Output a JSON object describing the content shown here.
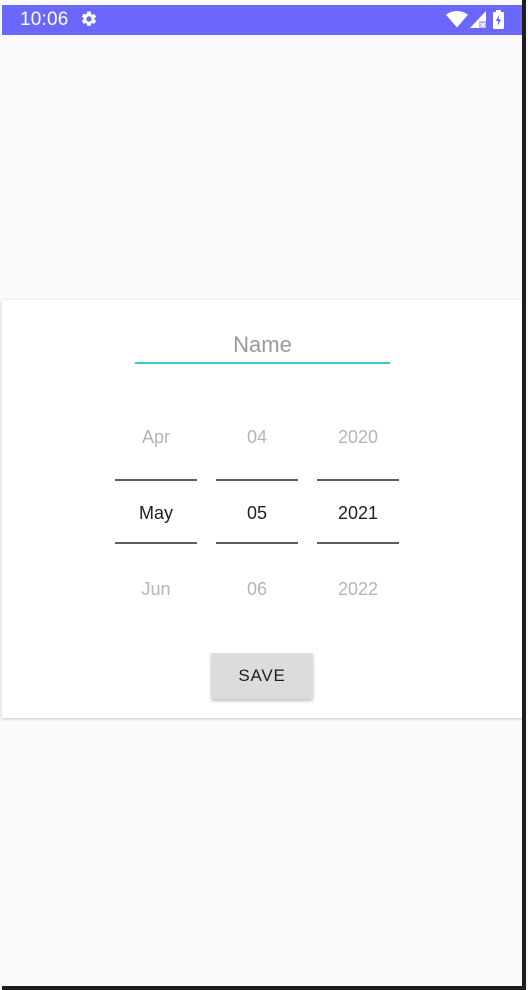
{
  "status_bar": {
    "time": "10:06",
    "background_color": "#6b67fb",
    "icons": [
      "settings-icon",
      "wifi-icon",
      "cellular-signal-icon",
      "battery-charging-icon"
    ]
  },
  "dialog": {
    "name_input": {
      "placeholder": "Name",
      "value": "",
      "underline_color": "#3bc8c8"
    },
    "date_picker": {
      "month": {
        "previous": "Apr",
        "selected": "May",
        "next": "Jun"
      },
      "day": {
        "previous": "04",
        "selected": "05",
        "next": "06"
      },
      "year": {
        "previous": "2020",
        "selected": "2021",
        "next": "2022"
      }
    },
    "save_button": {
      "label": "SAVE"
    }
  }
}
